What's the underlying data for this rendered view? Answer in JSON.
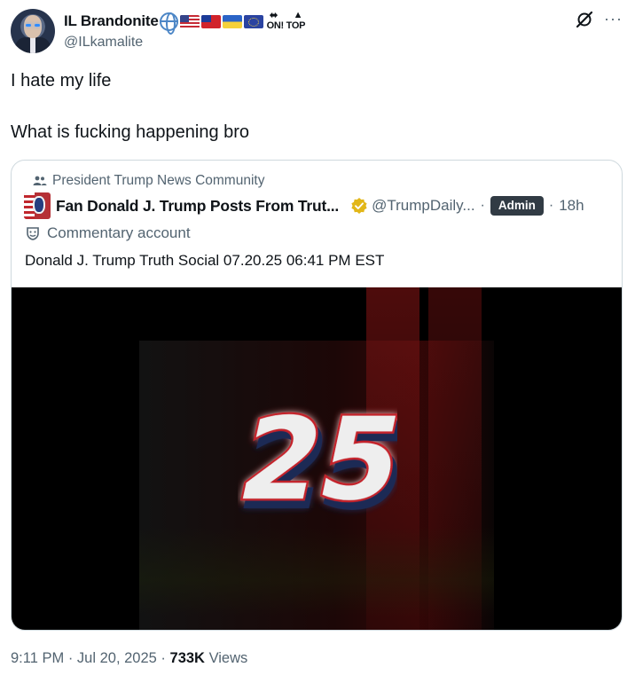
{
  "author": {
    "display_name": "IL Brandonite",
    "handle": "@ILkamalite",
    "name_emojis": [
      "globe-icon",
      "flag-us",
      "flag-taiwan",
      "flag-ukraine",
      "flag-eu",
      "on-top-icon"
    ],
    "on_top_text": "ON! TOP"
  },
  "tweet": {
    "lines": [
      "I hate my life",
      "What is fucking happening bro"
    ]
  },
  "quoted_post": {
    "community": "President Trump News Community",
    "author_name": "Fan Donald J. Trump Posts From Trut...",
    "author_handle": "@TrumpDaily...",
    "badge": "Admin",
    "age": "18h",
    "account_label": "Commentary account",
    "text": "Donald J. Trump Truth Social 07.20.25 06:41 PM EST",
    "media_text": "25"
  },
  "footer": {
    "time": "9:11 PM",
    "date": "Jul 20, 2025",
    "views_count": "733K",
    "views_label": "Views"
  },
  "colors": {
    "text_primary": "#0f1419",
    "text_secondary": "#536471",
    "border": "#cfd9de",
    "admin_badge": "#313b44",
    "verified_gold": "#e2b719"
  }
}
